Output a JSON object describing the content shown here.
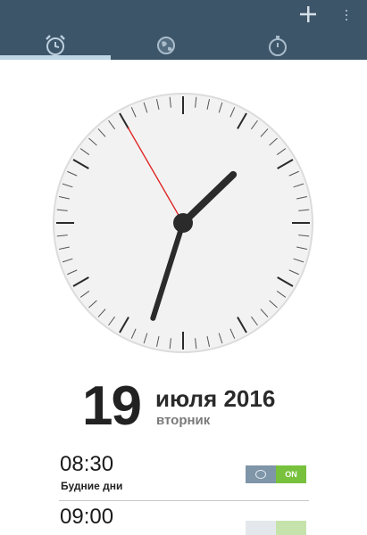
{
  "header": {
    "actions": {
      "add_icon": "plus-icon",
      "more_icon": "overflow-menu-icon"
    },
    "tabs": [
      {
        "icon": "alarm-clock-icon",
        "selected": true
      },
      {
        "icon": "globe-icon",
        "selected": false
      },
      {
        "icon": "stopwatch-icon",
        "selected": false
      }
    ],
    "colors": {
      "bar": "#3d5569",
      "indicator": "#bfd6e6"
    }
  },
  "clock": {
    "hours": 1,
    "minutes": 32,
    "seconds": 55,
    "second_hand_color": "#e02020"
  },
  "date": {
    "day": "19",
    "month_year": "июля 2016",
    "weekday": "вторник"
  },
  "alarms": [
    {
      "time": "08:30",
      "days": "Будние дни",
      "toggle_label": "ON",
      "enabled": true
    },
    {
      "time": "09:00",
      "days": "",
      "toggle_label": "",
      "enabled": true
    }
  ]
}
